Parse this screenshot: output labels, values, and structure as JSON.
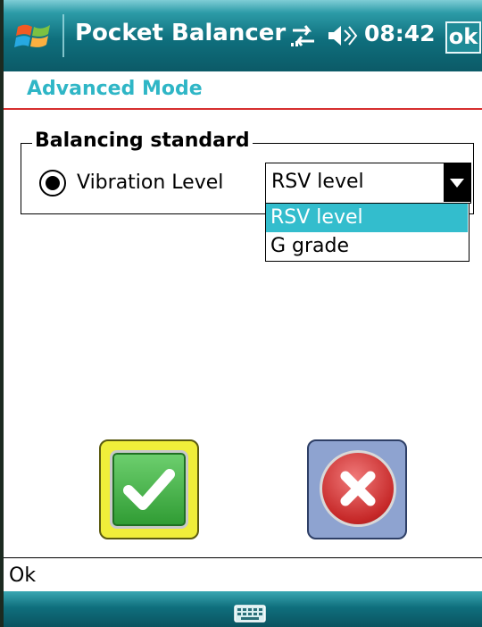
{
  "titlebar": {
    "app_title": "Pocket Balancer",
    "time": "08:42",
    "ok_label": "ok",
    "icons": [
      "windows-start-icon",
      "connectivity-icon",
      "volume-icon"
    ]
  },
  "page": {
    "title": "Advanced Mode"
  },
  "group": {
    "legend": "Balancing standard",
    "radio_label": "Vibration Level",
    "radio_selected": true,
    "dropdown": {
      "selected": "RSV level",
      "options": [
        "RSV level",
        "G grade"
      ],
      "highlighted": "RSV level"
    }
  },
  "buttons": {
    "accept_icon": "checkmark-icon",
    "cancel_icon": "close-x-icon"
  },
  "status": {
    "text": "Ok"
  },
  "bottombar": {
    "icon": "keyboard-icon"
  },
  "colors": {
    "accent": "#2fb6c6",
    "header_line": "#d62f2f",
    "selection": "#33bdcd",
    "titlebar": "#0f6f7d"
  }
}
